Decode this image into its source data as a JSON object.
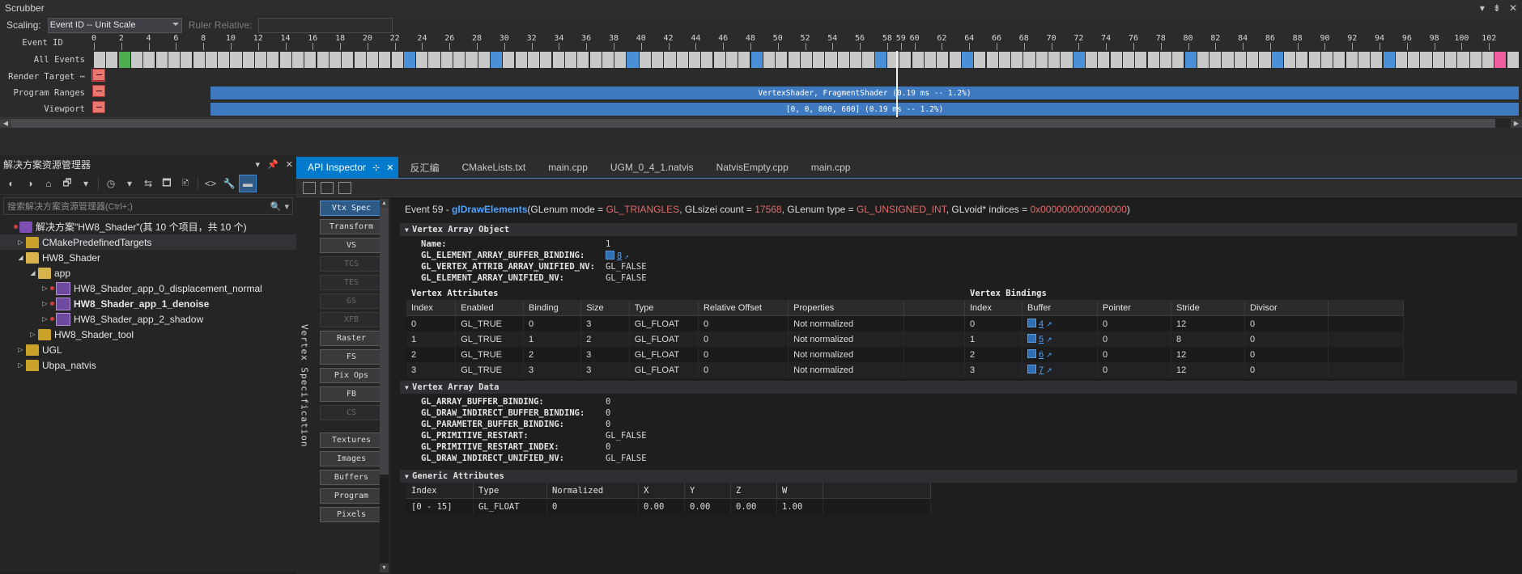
{
  "scrubber": {
    "title": "Scrubber",
    "win_buttons": [
      "▾",
      "⇟",
      "✕"
    ],
    "scaling_label": "Scaling:",
    "scaling_value": "Event ID -- Unit Scale",
    "ruler_label": "Ruler Relative:",
    "ruler_value": "",
    "rows": {
      "event_id": "Event ID",
      "all_events": "All Events",
      "render_target": "Render Target ⋯",
      "program_ranges": "Program Ranges",
      "viewport": "Viewport"
    },
    "ticks": [
      0,
      2,
      4,
      6,
      8,
      10,
      12,
      14,
      16,
      18,
      20,
      22,
      24,
      26,
      28,
      30,
      32,
      34,
      36,
      38,
      40,
      42,
      44,
      46,
      48,
      50,
      52,
      54,
      56,
      58,
      59,
      60,
      62,
      64,
      66,
      68,
      70,
      72,
      74,
      76,
      78,
      80,
      82,
      84,
      86,
      88,
      90,
      92,
      94,
      96,
      98,
      100,
      102
    ],
    "selected_event": 59,
    "selected_cell": 2,
    "blue_cells": [
      25,
      32,
      43,
      53,
      63,
      70,
      79,
      88,
      95,
      104
    ],
    "pink_cell": 113,
    "program_range_text": "VertexShader, FragmentShader (0.19 ms -- 1.2%)",
    "viewport_text": "[0, 0, 800, 600] (0.19 ms -- 1.2%)",
    "colors": {
      "bar": "#3f79c0",
      "selected_cell": "#4caf50",
      "playhead": "#f2f2f2"
    }
  },
  "solution_explorer": {
    "title": "解决方案资源管理器",
    "header_icons": [
      "▾",
      "📌",
      "✕"
    ],
    "toolbar": [
      {
        "name": "back-icon",
        "glyph": "◐"
      },
      {
        "name": "forward-icon",
        "glyph": "◑"
      },
      {
        "name": "home-icon",
        "glyph": "⌂"
      },
      {
        "name": "switch-views-icon",
        "glyph": "🗗"
      },
      {
        "name": "dropdown-icon",
        "glyph": "▾"
      },
      {
        "name": "pending-changes-icon",
        "glyph": "◷"
      },
      {
        "name": "dropdown2-icon",
        "glyph": "▾"
      },
      {
        "name": "refresh-icon",
        "glyph": "⇆"
      },
      {
        "name": "collapse-all-icon",
        "glyph": "🗖"
      },
      {
        "name": "show-all-files-icon",
        "glyph": "🗈"
      },
      {
        "name": "view-code-icon",
        "glyph": "<>"
      },
      {
        "name": "properties-icon",
        "glyph": "🔧"
      },
      {
        "name": "preview-selected-icon",
        "glyph": "▬"
      }
    ],
    "search_placeholder": "搜索解决方案资源管理器(Ctrl+;)",
    "tree": [
      {
        "depth": 0,
        "twisty": "",
        "icon": "sln",
        "label": "解决方案\"HW8_Shader\"(其 10 个项目，共 10 个)",
        "bold": false,
        "dot": true,
        "selected": false
      },
      {
        "depth": 1,
        "twisty": "▷",
        "icon": "folder",
        "label": "CMakePredefinedTargets",
        "bold": false,
        "dot": false,
        "selected": true
      },
      {
        "depth": 1,
        "twisty": "◢",
        "icon": "folder-open",
        "label": "HW8_Shader",
        "bold": false,
        "dot": false,
        "selected": false
      },
      {
        "depth": 2,
        "twisty": "◢",
        "icon": "folder-open",
        "label": "app",
        "bold": false,
        "dot": false,
        "selected": false
      },
      {
        "depth": 3,
        "twisty": "▷",
        "icon": "proj",
        "label": "HW8_Shader_app_0_displacement_normal",
        "bold": false,
        "dot": true,
        "selected": false
      },
      {
        "depth": 3,
        "twisty": "▷",
        "icon": "proj",
        "label": "HW8_Shader_app_1_denoise",
        "bold": true,
        "dot": true,
        "selected": false
      },
      {
        "depth": 3,
        "twisty": "▷",
        "icon": "proj",
        "label": "HW8_Shader_app_2_shadow",
        "bold": false,
        "dot": true,
        "selected": false
      },
      {
        "depth": 2,
        "twisty": "▷",
        "icon": "folder",
        "label": "HW8_Shader_tool",
        "bold": false,
        "dot": false,
        "selected": false
      },
      {
        "depth": 1,
        "twisty": "▷",
        "icon": "folder",
        "label": "UGL",
        "bold": false,
        "dot": false,
        "selected": false
      },
      {
        "depth": 1,
        "twisty": "▷",
        "icon": "folder",
        "label": "Ubpa_natvis",
        "bold": false,
        "dot": false,
        "selected": false
      }
    ]
  },
  "editor": {
    "tabs": [
      {
        "label": "API Inspector",
        "active": true,
        "pin": "⊹",
        "close": "✕"
      },
      {
        "label": "反汇编",
        "active": false
      },
      {
        "label": "CMakeLists.txt",
        "active": false
      },
      {
        "label": "main.cpp",
        "active": false
      },
      {
        "label": "UGM_0_4_1.natvis",
        "active": false
      },
      {
        "label": "NatvisEmpty.cpp",
        "active": false
      },
      {
        "label": "main.cpp",
        "active": false
      }
    ],
    "inspector_tools": [
      "grid-icon",
      "lock-icon",
      "panel-icon"
    ],
    "vertical_strip": "Vertex Specification",
    "stage_buttons": [
      {
        "label": "Vtx Spec",
        "state": "active"
      },
      {
        "label": "Transform",
        "state": "normal"
      },
      {
        "label": "VS",
        "state": "normal"
      },
      {
        "label": "TCS",
        "state": "disabled"
      },
      {
        "label": "TES",
        "state": "disabled"
      },
      {
        "label": "GS",
        "state": "disabled"
      },
      {
        "label": "XFB",
        "state": "disabled"
      },
      {
        "label": "Raster",
        "state": "normal"
      },
      {
        "label": "FS",
        "state": "normal"
      },
      {
        "label": "Pix Ops",
        "state": "normal"
      },
      {
        "label": "FB",
        "state": "normal"
      },
      {
        "label": "CS",
        "state": "disabled"
      },
      {
        "label": "Textures",
        "state": "normal",
        "gap": true
      },
      {
        "label": "Images",
        "state": "normal"
      },
      {
        "label": "Buffers",
        "state": "normal"
      },
      {
        "label": "Program",
        "state": "normal"
      },
      {
        "label": "Pixels",
        "state": "normal"
      }
    ],
    "event_line": {
      "prefix": "Event 59 -",
      "func": "glDrawElements",
      "p1_key": "(GLenum mode = ",
      "p1_val": "GL_TRIANGLES",
      "p2_key": ", GLsizei count = ",
      "p2_val": "17568",
      "p3_key": ", GLenum type = ",
      "p3_val": "GL_UNSIGNED_INT",
      "p4_key": ", GLvoid* indices = ",
      "p4_val": "0x0000000000000000",
      "suffix": ")"
    },
    "vao_section": {
      "title": "Vertex Array Object",
      "rows": [
        {
          "key": "Name:",
          "value": "1",
          "link": false
        },
        {
          "key": "GL_ELEMENT_ARRAY_BUFFER_BINDING:",
          "value": "8",
          "link": true
        },
        {
          "key": "GL_VERTEX_ATTRIB_ARRAY_UNIFIED_NV:",
          "value": "GL_FALSE",
          "link": false
        },
        {
          "key": "GL_ELEMENT_ARRAY_UNIFIED_NV:",
          "value": "GL_FALSE",
          "link": false
        }
      ]
    },
    "vertex_attributes": {
      "title": "Vertex Attributes",
      "columns": [
        "Index",
        "Enabled",
        "Binding",
        "Size",
        "Type",
        "Relative Offset",
        "Properties",
        ""
      ],
      "rows": [
        [
          "0",
          "GL_TRUE",
          "0",
          "3",
          "GL_FLOAT",
          "0",
          "Not normalized",
          ""
        ],
        [
          "1",
          "GL_TRUE",
          "1",
          "2",
          "GL_FLOAT",
          "0",
          "Not normalized",
          ""
        ],
        [
          "2",
          "GL_TRUE",
          "2",
          "3",
          "GL_FLOAT",
          "0",
          "Not normalized",
          ""
        ],
        [
          "3",
          "GL_TRUE",
          "3",
          "3",
          "GL_FLOAT",
          "0",
          "Not normalized",
          ""
        ]
      ]
    },
    "vertex_bindings": {
      "title": "Vertex Bindings",
      "columns": [
        "Index",
        "Buffer",
        "Pointer",
        "Stride",
        "Divisor",
        ""
      ],
      "rows": [
        [
          "0",
          "4",
          "0",
          "12",
          "0",
          ""
        ],
        [
          "1",
          "5",
          "0",
          "8",
          "0",
          ""
        ],
        [
          "2",
          "6",
          "0",
          "12",
          "0",
          ""
        ],
        [
          "3",
          "7",
          "0",
          "12",
          "0",
          ""
        ]
      ]
    },
    "vertex_array_data": {
      "title": "Vertex Array Data",
      "rows": [
        {
          "key": "GL_ARRAY_BUFFER_BINDING:",
          "value": "0"
        },
        {
          "key": "GL_DRAW_INDIRECT_BUFFER_BINDING:",
          "value": "0"
        },
        {
          "key": "GL_PARAMETER_BUFFER_BINDING:",
          "value": "0"
        },
        {
          "key": "GL_PRIMITIVE_RESTART:",
          "value": "GL_FALSE"
        },
        {
          "key": "GL_PRIMITIVE_RESTART_INDEX:",
          "value": "0"
        },
        {
          "key": "GL_DRAW_INDIRECT_UNIFIED_NV:",
          "value": "GL_FALSE"
        }
      ]
    },
    "generic_attributes": {
      "title": "Generic Attributes",
      "columns": [
        "Index",
        "Type",
        "Normalized",
        "X",
        "Y",
        "Z",
        "W",
        ""
      ],
      "rows": [
        [
          "[0 - 15]",
          "GL_FLOAT",
          "0",
          "0.00",
          "0.00",
          "0.00",
          "1.00",
          ""
        ]
      ]
    }
  }
}
